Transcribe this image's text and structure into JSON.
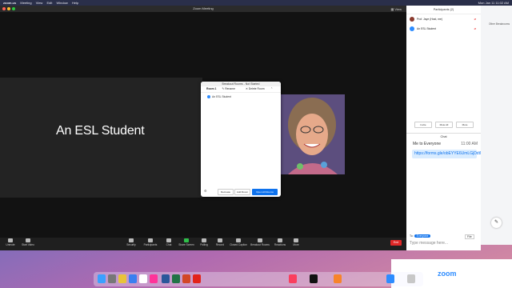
{
  "menubar": {
    "app": "zoom.us",
    "items": [
      "Meeting",
      "View",
      "Edit",
      "Window",
      "Help"
    ],
    "clock": "Mon Jan 11 11:02 AM"
  },
  "window": {
    "title": "Zoom Meeting",
    "view_label": "View"
  },
  "speaker": {
    "name": "An ESL Student"
  },
  "breakout": {
    "title": "Breakout Rooms - Not Started",
    "room": "Room 1",
    "rename": "Rename",
    "delete": "Delete Room",
    "participant": "An ESL Student",
    "recreate": "Recreate",
    "add_room": "Add Room",
    "open_all": "Open All Rooms"
  },
  "toolbar": {
    "items": [
      "Unmute",
      "Start Video",
      "Security",
      "Participants",
      "Chat",
      "Share Screen",
      "Polling",
      "Record",
      "Closed Caption",
      "Breakout Rooms",
      "Reactions",
      "More"
    ],
    "end": "End"
  },
  "participants": {
    "title": "Participants (2)",
    "list": [
      {
        "name": "Prof. Jaye (Host, me)",
        "color": "#8a3b2e"
      },
      {
        "name": "An ESL Student",
        "color": "#2d8cff"
      }
    ],
    "buttons": [
      "Invite",
      "Mute All",
      "More"
    ]
  },
  "chat": {
    "title": "Chat",
    "sender": "Me to Everyone",
    "time": "11:00 AM",
    "message": "https://forms.gle/obEYYE6UmLGjDdtNA",
    "to_label": "To:",
    "to_target": "Everyone",
    "file_label": "File",
    "input_placeholder": "Type message here..."
  },
  "right_panel": {
    "other_breakrooms": "Other Breakrooms"
  },
  "banner": {
    "logo": "zoom"
  },
  "colors": {
    "accent": "#0e72ed",
    "end": "#e02828"
  }
}
